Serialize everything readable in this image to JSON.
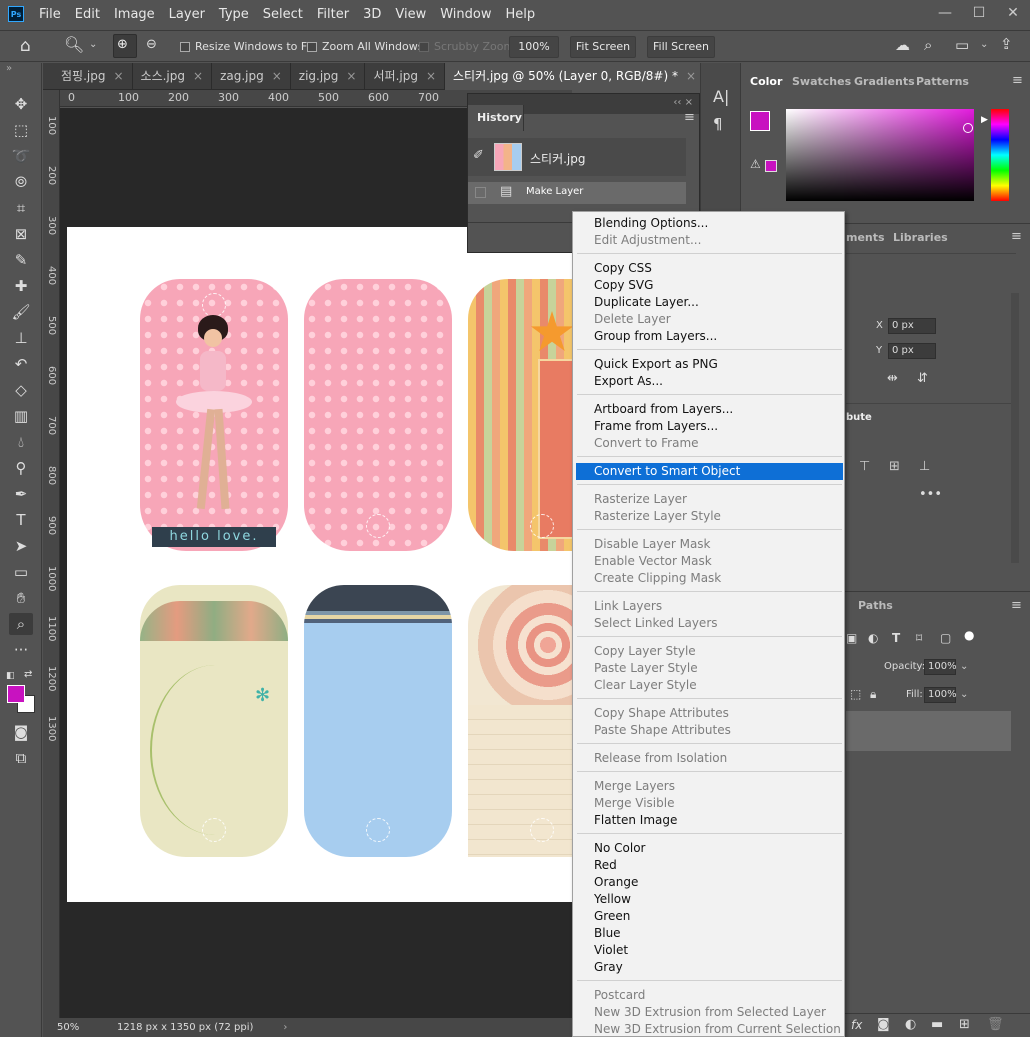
{
  "menubar": {
    "logo": "Ps",
    "items": [
      "File",
      "Edit",
      "Image",
      "Layer",
      "Type",
      "Select",
      "Filter",
      "3D",
      "View",
      "Window",
      "Help"
    ]
  },
  "window_controls": {
    "minimize": "—",
    "restore": "☐",
    "close": "✕"
  },
  "options": {
    "resize_windows": "Resize Windows to Fit",
    "zoom_all": "Zoom All Windows",
    "scrubby": "Scrubby Zoom",
    "zoom_value": "100%",
    "fit_screen": "Fit Screen",
    "fill_screen": "Fill Screen"
  },
  "tabs": [
    {
      "label": "점핑.jpg"
    },
    {
      "label": "소스.jpg"
    },
    {
      "label": "zag.jpg"
    },
    {
      "label": "zig.jpg"
    },
    {
      "label": "서퍼.jpg"
    },
    {
      "label": "스티커.jpg @ 50% (Layer 0, RGB/8#) *"
    }
  ],
  "ruler": {
    "top_ticks": [
      "0",
      "100",
      "200",
      "300",
      "400",
      "500",
      "600",
      "700"
    ],
    "left_ticks": [
      "100",
      "200",
      "300",
      "400",
      "500",
      "600",
      "700",
      "800",
      "900",
      "1000",
      "1100",
      "1200",
      "1300"
    ]
  },
  "canvas": {
    "tag_text": "hello love."
  },
  "status": {
    "zoom": "50%",
    "doc_info": "1218 px x 1350 px (72 ppi)",
    "arrow": "›"
  },
  "history": {
    "title": "History",
    "snapshot": "스티커.jpg",
    "step": "Make Layer"
  },
  "right": {
    "color_tabs": [
      "Color",
      "Swatches",
      "Gradients",
      "Patterns"
    ],
    "mid_tabs": [
      "ments",
      "Libraries"
    ],
    "x_label": "X",
    "x_value": "0 px",
    "y_label": "Y",
    "y_value": "0 px",
    "attr_label": "bute",
    "paths_tab": "Paths",
    "opacity_label": "Opacity:",
    "opacity_value": "100%",
    "fill_label": "Fill:",
    "fill_value": "100%",
    "fx_label": "fx"
  },
  "colors": {
    "foreground": "#c812c0",
    "accent": "#0e6fd6"
  },
  "context_menu": {
    "groups": [
      [
        {
          "label": "Blending Options...",
          "enabled": true
        },
        {
          "label": "Edit Adjustment...",
          "enabled": false
        }
      ],
      [
        {
          "label": "Copy CSS",
          "enabled": true
        },
        {
          "label": "Copy SVG",
          "enabled": true
        },
        {
          "label": "Duplicate Layer...",
          "enabled": true
        },
        {
          "label": "Delete Layer",
          "enabled": false
        },
        {
          "label": "Group from Layers...",
          "enabled": true
        }
      ],
      [
        {
          "label": "Quick Export as PNG",
          "enabled": true
        },
        {
          "label": "Export As...",
          "enabled": true
        }
      ],
      [
        {
          "label": "Artboard from Layers...",
          "enabled": true
        },
        {
          "label": "Frame from Layers...",
          "enabled": true
        },
        {
          "label": "Convert to Frame",
          "enabled": false
        }
      ],
      [
        {
          "label": "Convert to Smart Object",
          "enabled": true,
          "highlighted": true
        }
      ],
      [
        {
          "label": "Rasterize Layer",
          "enabled": false
        },
        {
          "label": "Rasterize Layer Style",
          "enabled": false
        }
      ],
      [
        {
          "label": "Disable Layer Mask",
          "enabled": false
        },
        {
          "label": "Enable Vector Mask",
          "enabled": false
        },
        {
          "label": "Create Clipping Mask",
          "enabled": false
        }
      ],
      [
        {
          "label": "Link Layers",
          "enabled": false
        },
        {
          "label": "Select Linked Layers",
          "enabled": false
        }
      ],
      [
        {
          "label": "Copy Layer Style",
          "enabled": false
        },
        {
          "label": "Paste Layer Style",
          "enabled": false
        },
        {
          "label": "Clear Layer Style",
          "enabled": false
        }
      ],
      [
        {
          "label": "Copy Shape Attributes",
          "enabled": false
        },
        {
          "label": "Paste Shape Attributes",
          "enabled": false
        }
      ],
      [
        {
          "label": "Release from Isolation",
          "enabled": false
        }
      ],
      [
        {
          "label": "Merge Layers",
          "enabled": false
        },
        {
          "label": "Merge Visible",
          "enabled": false
        },
        {
          "label": "Flatten Image",
          "enabled": true
        }
      ],
      [
        {
          "label": "No Color",
          "enabled": true
        },
        {
          "label": "Red",
          "enabled": true
        },
        {
          "label": "Orange",
          "enabled": true
        },
        {
          "label": "Yellow",
          "enabled": true
        },
        {
          "label": "Green",
          "enabled": true
        },
        {
          "label": "Blue",
          "enabled": true
        },
        {
          "label": "Violet",
          "enabled": true
        },
        {
          "label": "Gray",
          "enabled": true
        }
      ],
      [
        {
          "label": "Postcard",
          "enabled": false
        },
        {
          "label": "New 3D Extrusion from Selected Layer",
          "enabled": false
        },
        {
          "label": "New 3D Extrusion from Current Selection",
          "enabled": false
        }
      ]
    ]
  }
}
